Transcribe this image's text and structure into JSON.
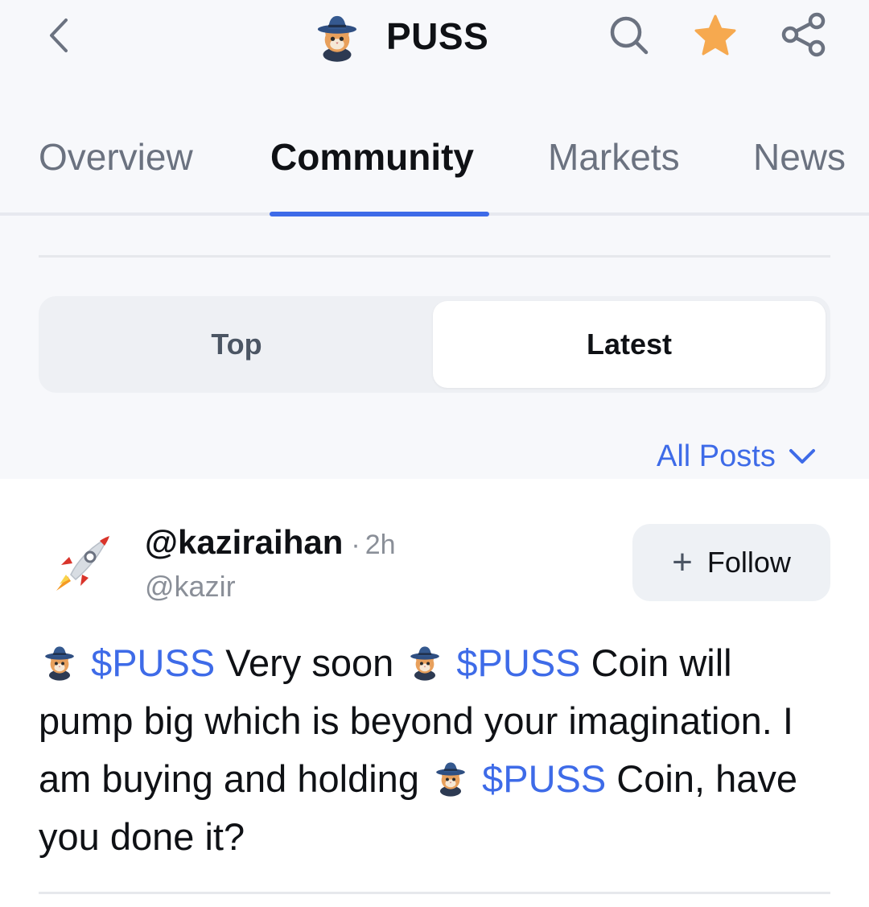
{
  "header": {
    "title": "PUSS",
    "icons": [
      "back-chevron-icon",
      "puss-coin-logo",
      "search-icon",
      "star-icon",
      "share-icon"
    ],
    "star_color": "#f6a94f"
  },
  "tabs": [
    {
      "label": "Overview",
      "active": false
    },
    {
      "label": "Community",
      "active": true
    },
    {
      "label": "Markets",
      "active": false
    },
    {
      "label": "News",
      "active": false
    }
  ],
  "segment": {
    "options": [
      "Top",
      "Latest"
    ],
    "selected": "Latest"
  },
  "filter": {
    "label": "All Posts"
  },
  "post": {
    "author": "@kaziraihan",
    "separator": "·",
    "time": "2h",
    "handle": "@kazir",
    "follow_label": "Follow",
    "avatar_icon": "rocket-icon",
    "body": {
      "tag": "$PUSS",
      "t1": " Very soon ",
      "t2": "  Coin will pump big which is beyond your imagination. I am buying and holding ",
      "t3": "  Coin, have you done it?"
    }
  },
  "colors": {
    "accent": "#3e6be8",
    "background_top": "#f7f8fb",
    "muted": "#6b7280"
  }
}
